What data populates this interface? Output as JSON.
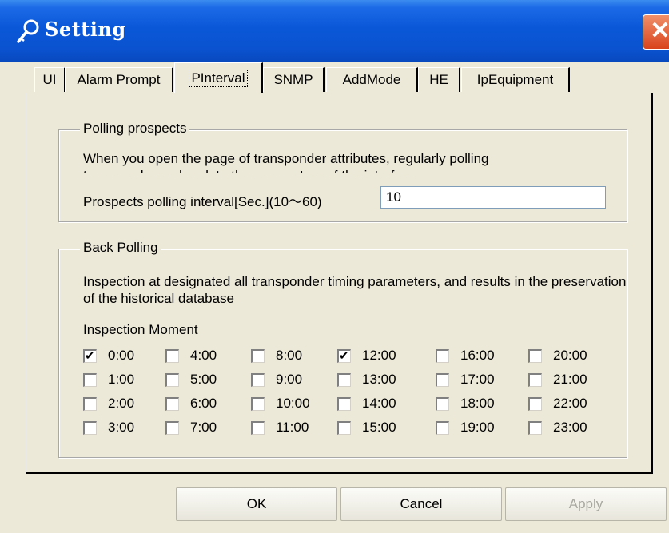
{
  "window": {
    "title": "Setting",
    "close_icon": "close-x-icon",
    "title_icon": "key-icon"
  },
  "tabs": [
    {
      "label": "UI"
    },
    {
      "label": "Alarm Prompt"
    },
    {
      "label": "PInterval",
      "active": true
    },
    {
      "label": "SNMP"
    },
    {
      "label": "AddMode"
    },
    {
      "label": "HE"
    },
    {
      "label": "IpEquipment"
    }
  ],
  "polling_prospects": {
    "title": "Polling prospects",
    "description_line1": "When you open the page of transponder attributes, regularly polling",
    "description_line2": "transponder and update the parameters of the interface",
    "interval_label": "Prospects polling interval[Sec.](10～60)",
    "interval_value": "10"
  },
  "back_polling": {
    "title": "Back Polling",
    "description": "Inspection at designated all transponder timing parameters, and results in the preservation of the historical database",
    "moment_label": "Inspection Moment",
    "hours": [
      {
        "label": "0:00",
        "checked": true
      },
      {
        "label": "1:00",
        "checked": false
      },
      {
        "label": "2:00",
        "checked": false
      },
      {
        "label": "3:00",
        "checked": false
      },
      {
        "label": "4:00",
        "checked": false
      },
      {
        "label": "5:00",
        "checked": false
      },
      {
        "label": "6:00",
        "checked": false
      },
      {
        "label": "7:00",
        "checked": false
      },
      {
        "label": "8:00",
        "checked": false
      },
      {
        "label": "9:00",
        "checked": false
      },
      {
        "label": "10:00",
        "checked": false
      },
      {
        "label": "11:00",
        "checked": false
      },
      {
        "label": "12:00",
        "checked": true
      },
      {
        "label": "13:00",
        "checked": false
      },
      {
        "label": "14:00",
        "checked": false
      },
      {
        "label": "15:00",
        "checked": false
      },
      {
        "label": "16:00",
        "checked": false
      },
      {
        "label": "17:00",
        "checked": false
      },
      {
        "label": "18:00",
        "checked": false
      },
      {
        "label": "19:00",
        "checked": false
      },
      {
        "label": "20:00",
        "checked": false
      },
      {
        "label": "21:00",
        "checked": false
      },
      {
        "label": "22:00",
        "checked": false
      },
      {
        "label": "23:00",
        "checked": false
      }
    ]
  },
  "buttons": {
    "ok": "OK",
    "cancel": "Cancel",
    "apply": "Apply"
  },
  "colors": {
    "titlebar": "#0a58d8",
    "dialog_bg": "#ece9d8",
    "close_button": "#d9431c"
  }
}
